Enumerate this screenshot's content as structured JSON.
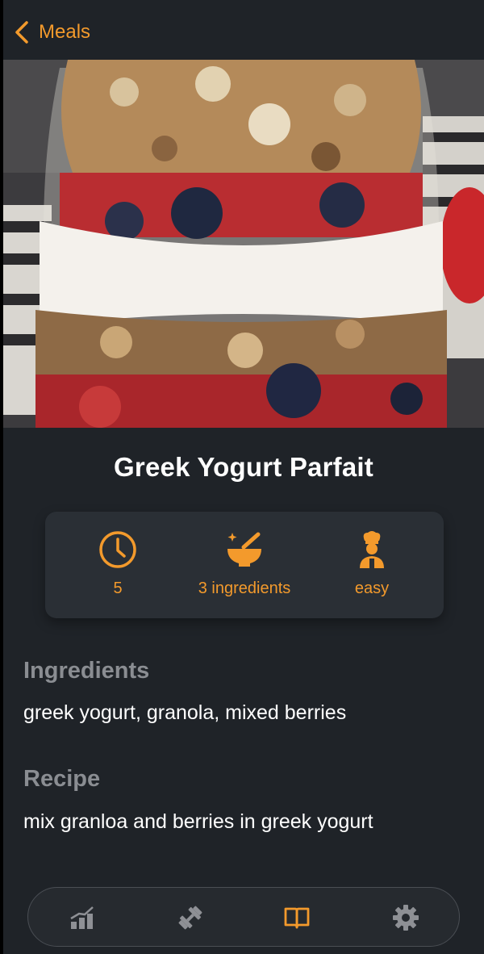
{
  "nav": {
    "back_label": "Meals"
  },
  "meal": {
    "title": "Greek Yogurt Parfait",
    "stats": {
      "time": "5",
      "ingredients_count": "3 ingredients",
      "difficulty": "easy"
    },
    "ingredients_heading": "Ingredients",
    "ingredients_text": "greek yogurt, granola, mixed berries",
    "recipe_heading": "Recipe",
    "recipe_text": "mix granloa and berries in greek yogurt"
  },
  "icons": {
    "back": "chevron-left-icon",
    "time": "clock-icon",
    "ingredients": "mortar-pestle-icon",
    "difficulty": "chef-icon",
    "tabs": [
      "chart-icon",
      "dumbbell-icon",
      "book-icon",
      "gear-icon"
    ]
  },
  "tabbar": {
    "active_index": 2
  },
  "colors": {
    "accent": "#f39a2c",
    "background": "#1f2328",
    "card": "#2a2f35",
    "muted_heading": "#8a8d92",
    "inactive_tab": "#8e9095"
  }
}
